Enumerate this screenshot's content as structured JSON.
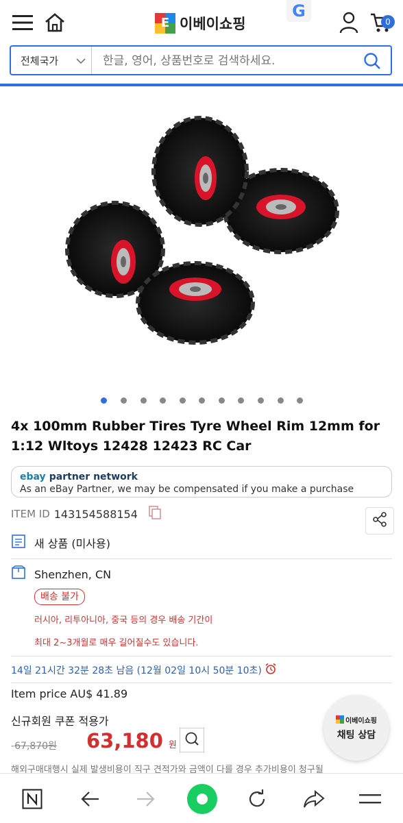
{
  "header": {
    "logo_badge": "E",
    "logo_text": "이베이쇼핑",
    "cart_count": "0",
    "country_label": "전체국가",
    "search_placeholder": "한글, 영어, 상품번호로 검색하세요."
  },
  "gallery": {
    "total_dots": 11,
    "active_index": 0
  },
  "product": {
    "title": "4x 100mm Rubber Tires Tyre Wheel Rim 12mm for 1:12 Wltoys 12428 12423 RC Car",
    "partner_brand_1": "ebay",
    "partner_brand_2": "partner network",
    "partner_note": "As an eBay Partner, we may be compensated if you make a purchase",
    "item_id_label": "ITEM ID",
    "item_id": "143154588154",
    "condition": "새 상품 (미사용)",
    "location": "Shenzhen, CN",
    "shipping_badge": "배송 불가",
    "shipping_note_1": "러시아, 리투아니아, 중국 등의 경우 배송 기간이",
    "shipping_note_2": "최대 2~3개월로 매우 길어질수도 있습니다.",
    "timer": "14일 21시간 32분 28초 남음 (12월 02일 10시 50분 10초)",
    "item_price": "Item price AU$ 41.89",
    "coupon_label": "신규회원 쿠폰 적용가",
    "original_price": "67,870원",
    "sale_price": "63,180",
    "currency": "원",
    "footnote": "해외구매대행시 실제 발생비용이 직구 견적가와 금액이 다를 경우 추가비용이 청구될"
  },
  "chat": {
    "logo": "이베이쇼핑",
    "label": "채팅 상담"
  },
  "colors": {
    "accent": "#2d6ee0",
    "sale": "#d0302f",
    "rim": "#d8142a"
  }
}
